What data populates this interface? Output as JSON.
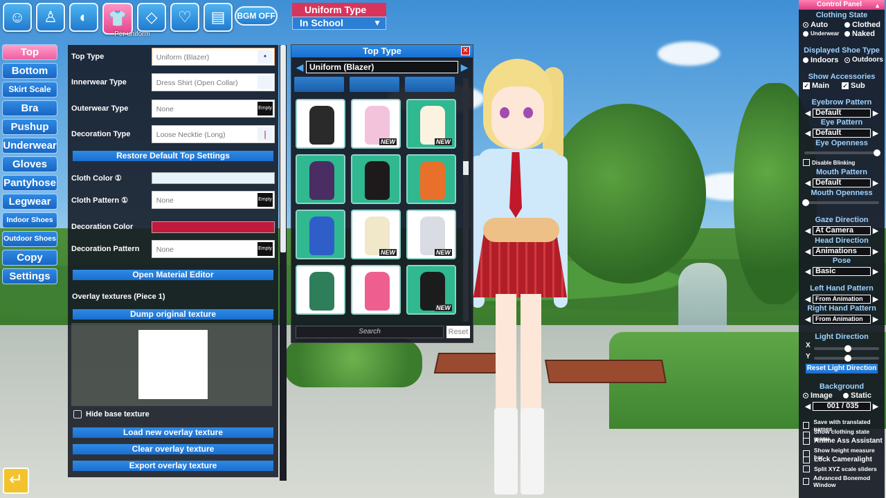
{
  "top_bar": {
    "categories": [
      {
        "name": "face-icon",
        "glyph": "☺"
      },
      {
        "name": "body-icon",
        "glyph": "♙"
      },
      {
        "name": "hair-icon",
        "glyph": "◐"
      },
      {
        "name": "clothes-icon",
        "glyph": "👕",
        "active": true
      },
      {
        "name": "accessory-icon",
        "glyph": "◇"
      },
      {
        "name": "heart-icon",
        "glyph": "♡"
      },
      {
        "name": "document-icon",
        "glyph": "▤"
      }
    ],
    "active_caption": "Per uniform",
    "bgm_label": "BGM OFF"
  },
  "uniform": {
    "header": "Uniform Type",
    "selected": "In School"
  },
  "left_menu": {
    "items": [
      "Top",
      "Bottom",
      "Skirt Scale",
      "Bra",
      "Pushup",
      "Underwear",
      "Gloves",
      "Pantyhose",
      "Legwear",
      "Indoor Shoes",
      "Outdoor Shoes",
      "Copy",
      "Settings"
    ],
    "active": "Top"
  },
  "settings": {
    "top_type_label": "Top Type",
    "top_type_value": "Uniform (Blazer)",
    "innerwear_label": "Innerwear Type",
    "innerwear_value": "Dress Shirt (Open Collar)",
    "outerwear_label": "Outerwear Type",
    "outerwear_value": "None",
    "decoration_type_label": "Decoration Type",
    "decoration_type_value": "Loose Necktie (Long)",
    "restore_button": "Restore Default Top Settings",
    "cloth_color_label": "Cloth Color ①",
    "cloth_color": "#e8f4fb",
    "cloth_pattern_label": "Cloth Pattern ①",
    "cloth_pattern_value": "None",
    "decoration_color_label": "Decoration Color",
    "decoration_color": "#c21a3c",
    "decoration_pattern_label": "Decoration Pattern",
    "decoration_pattern_value": "None",
    "empty_label": "Empty",
    "material_editor_button": "Open Material Editor",
    "overlay_title": "Overlay textures (Piece 1)",
    "dump_button": "Dump original texture",
    "hide_base_label": "Hide base texture",
    "load_button": "Load new overlay texture",
    "clear_button": "Clear overlay texture",
    "export_button": "Export overlay texture"
  },
  "type_window": {
    "title": "Top Type",
    "current": "Uniform (Blazer)",
    "new_badge": "NEW",
    "search_placeholder": "Search",
    "reset_label": "Reset",
    "tiles": [
      {
        "name": "tile-dark-harness",
        "bg": "#ffffff",
        "fg": "#2a2a2a",
        "new": false
      },
      {
        "name": "tile-pink-ribbon-top",
        "bg": "#ffffff",
        "fg": "#f3c3dc",
        "new": true
      },
      {
        "name": "tile-white-frill-top",
        "bg": "#30b890",
        "fg": "#fbf3df",
        "new": true
      },
      {
        "name": "tile-purple-armor",
        "bg": "#30b890",
        "fg": "#4a2d63",
        "new": false
      },
      {
        "name": "tile-black-gold-coat",
        "bg": "#30b890",
        "fg": "#1e1a1c",
        "new": false
      },
      {
        "name": "tile-orange-leotard",
        "bg": "#30b890",
        "fg": "#e8702a",
        "new": false
      },
      {
        "name": "tile-blue-suit",
        "bg": "#30b890",
        "fg": "#2f5ec9",
        "new": false
      },
      {
        "name": "tile-white-gold-top",
        "bg": "#ffffff",
        "fg": "#f1e7c9",
        "new": true
      },
      {
        "name": "tile-white-armor-top",
        "bg": "#ffffff",
        "fg": "#d9dde3",
        "new": true
      },
      {
        "name": "tile-green-dress",
        "bg": "#ffffff",
        "fg": "#2f7e5b",
        "new": false
      },
      {
        "name": "tile-pink-hero-suit",
        "bg": "#ffffff",
        "fg": "#ee5f8f",
        "new": false
      },
      {
        "name": "tile-black-tank",
        "bg": "#30b890",
        "fg": "#1c1c1c",
        "new": true
      }
    ]
  },
  "control_panel": {
    "title": "Control Panel",
    "clothing_state_title": "Clothing State",
    "auto": "Auto",
    "clothed": "Clothed",
    "underwear": "Underwear",
    "naked": "Naked",
    "shoe_title": "Displayed Shoe Type",
    "indoors": "Indoors",
    "outdoors": "Outdoors",
    "accessories_title": "Show Accessories",
    "main": "Main",
    "sub": "Sub",
    "eyebrow_title": "Eyebrow Pattern",
    "eyebrow_value": "Default",
    "eye_title": "Eye Pattern",
    "eye_value": "Default",
    "eye_openness_title": "Eye Openness",
    "eye_openness": 0.97,
    "disable_blinking": "Disable Blinking",
    "mouth_title": "Mouth Pattern",
    "mouth_value": "Default",
    "mouth_openness_title": "Mouth Openness",
    "mouth_openness": 0.02,
    "gaze_title": "Gaze Direction",
    "gaze_value": "At Camera",
    "head_title": "Head Direction",
    "head_value": "Animations",
    "pose_title": "Pose",
    "pose_value": "Basic",
    "left_hand_title": "Left Hand Pattern",
    "left_hand_value": "From Animation",
    "right_hand_title": "Right Hand Pattern",
    "right_hand_value": "From Animation",
    "light_title": "Light Direction",
    "light_x_label": "X",
    "light_y_label": "Y",
    "light_x": 0.52,
    "light_y": 0.52,
    "reset_light": "Reset Light Direction",
    "background_title": "Background",
    "image": "Image",
    "static": "Static",
    "background_value": "001 / 035",
    "options": [
      {
        "label": "Save with translated names",
        "big": false
      },
      {
        "label": "Show clothing state menu",
        "big": false
      },
      {
        "label": "Anime Ass Assistant",
        "big": true
      },
      {
        "label": "Show height measure bar",
        "big": false
      },
      {
        "label": "Lock Cameralight",
        "big": true
      },
      {
        "label": "Split XYZ scale sliders",
        "big": false
      },
      {
        "label": "Advanced Bonemod Window",
        "big": false
      }
    ]
  }
}
